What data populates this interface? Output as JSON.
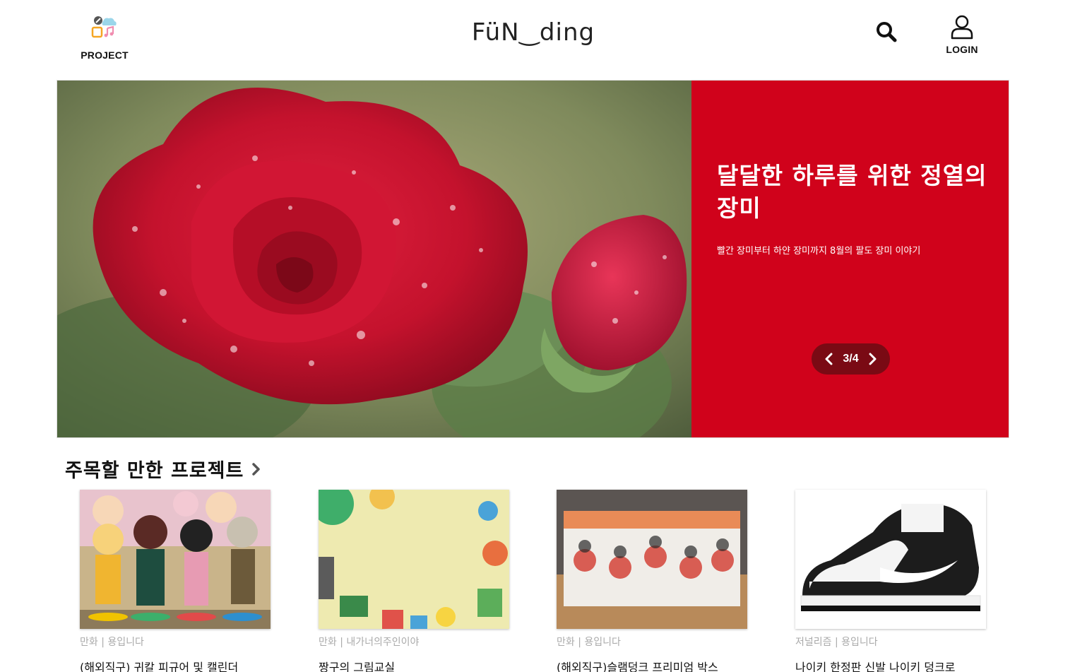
{
  "header": {
    "project_label": "PROJECT",
    "logo_text": "FüN‿ding",
    "login_label": "LOGIN",
    "icons": [
      "project-icon",
      "search-icon",
      "user-icon"
    ]
  },
  "hero": {
    "title": "달달한 하루를 위한 정열의 장미",
    "subtitle": "빨간 장미부터 하얀 장미까지 8월의 팔도 장미 이야기",
    "pager": "3/4",
    "accent_color": "#d0021b",
    "pager_bg": "#7a0a14"
  },
  "section": {
    "title": "주목할 만한 프로젝트"
  },
  "cards": [
    {
      "category": "만화 | 용입니다",
      "title": "(해외직구) 귀칼 피규어 및 캘린더"
    },
    {
      "category": "만화 | 내가너의주인이야",
      "title": "짱구의 그림교실"
    },
    {
      "category": "만화 | 용입니다",
      "title": "(해외직구)슬램덩크 프리미엄 박스"
    },
    {
      "category": "저널리즘 | 용입니다",
      "title": "나이키 한정판 신발 나이키 덩크로"
    }
  ]
}
